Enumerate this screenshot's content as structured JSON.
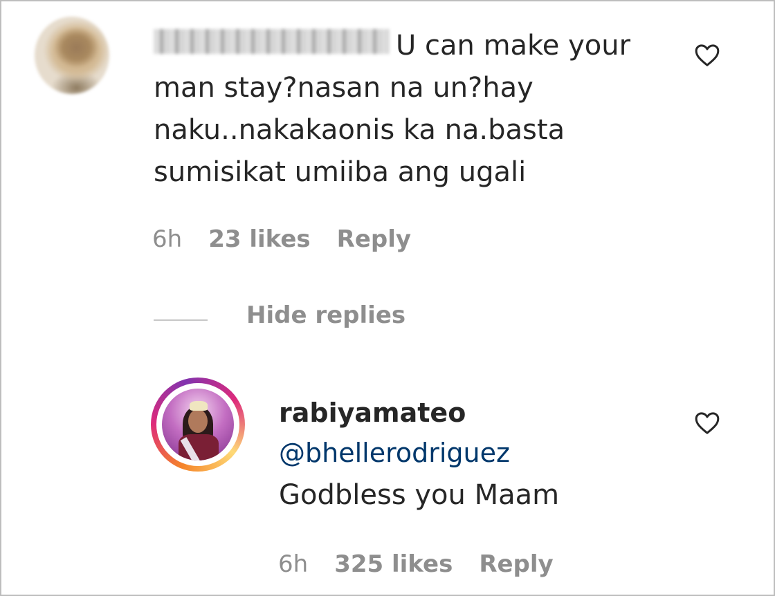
{
  "comment": {
    "text": "U can make your\nman stay?nasan na un?hay\nnaku..nakakaonis ka na.basta\nsumisikat umiiba ang ugali",
    "time": "6h",
    "likes": "23 likes",
    "reply_label": "Reply"
  },
  "thread": {
    "hide_replies_label": "Hide replies"
  },
  "reply": {
    "username": "rabiyamateo",
    "mention": "@bhellerodriguez",
    "text": "Godbless you Maam",
    "time": "6h",
    "likes": "325 likes",
    "reply_label": "Reply"
  },
  "icons": {
    "like": "heart-outline-icon"
  },
  "colors": {
    "text": "#262626",
    "secondary": "#8e8e8e",
    "mention": "#00376b",
    "story_ring": [
      "#f58529",
      "#dd2a7b",
      "#8134af"
    ]
  }
}
